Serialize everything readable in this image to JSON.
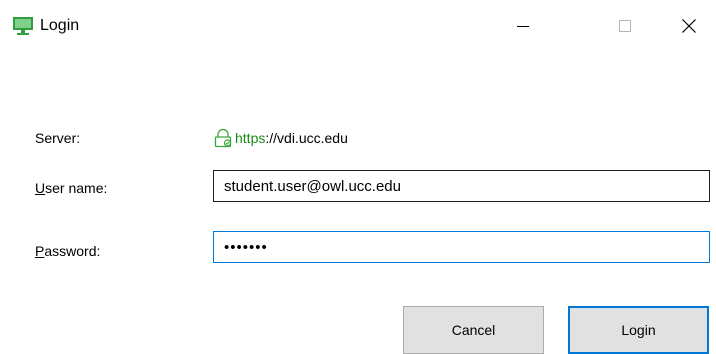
{
  "window": {
    "title": "Login",
    "icon": "monitor-icon",
    "controls": {
      "minimize": "minimize-icon",
      "maximize": "maximize-icon",
      "close": "close-icon"
    }
  },
  "form": {
    "server": {
      "label": "Server:",
      "scheme": "https",
      "rest": "://vdi.ucc.edu",
      "icon": "lock-icon"
    },
    "username": {
      "label_accel": "U",
      "label_rest": "ser name:",
      "value": "student.user@owl.ucc.edu"
    },
    "password": {
      "label_accel": "P",
      "label_rest": "assword:",
      "value": "•••••••"
    }
  },
  "buttons": {
    "cancel": "Cancel",
    "login": "Login"
  },
  "colors": {
    "accent": "#0078d7",
    "secure": "#1a8a1a",
    "button_face": "#e1e1e1",
    "icon_green": "#2e9e3e"
  }
}
